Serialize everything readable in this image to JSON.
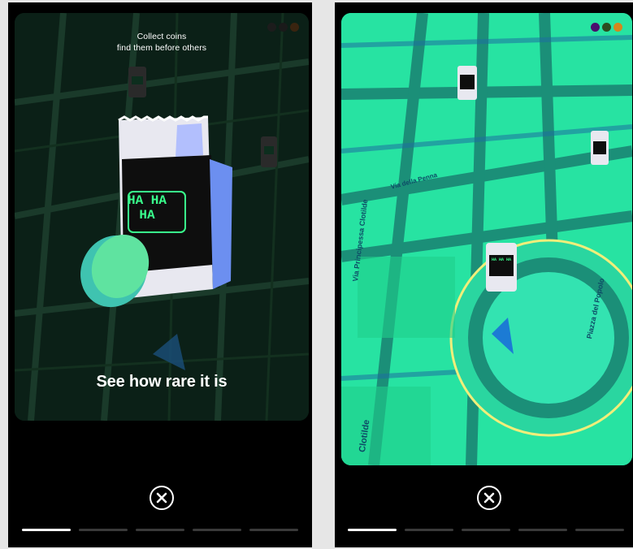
{
  "screens": [
    {
      "caption_top_line1": "Collect coins",
      "caption_top_line2": "find them before others",
      "caption_bottom": "See how rare it is",
      "pack_label": "HA HA HA",
      "close_icon": "close-circle-icon",
      "progress_segments": 5,
      "active_segment": 0,
      "dots": [
        "#1c1c1c",
        "#1a1a1a",
        "#3a2410"
      ]
    },
    {
      "map_streets": [
        "Via Principessa Clotilde",
        "Piazza del Popolo",
        "Clotilde",
        "Via della Penna"
      ],
      "pack_label": "HA HA HA",
      "close_icon": "close-circle-icon",
      "progress_segments": 5,
      "active_segment": 0,
      "dots": [
        "#4a0f6e",
        "#2c4d1f",
        "#d4861c"
      ]
    }
  ],
  "colors": {
    "background": "#e6e6e6",
    "panel": "#000000",
    "map_dark": "#0b2017",
    "map_bright": "#27e3a2",
    "accent_green": "#39ff8c"
  }
}
